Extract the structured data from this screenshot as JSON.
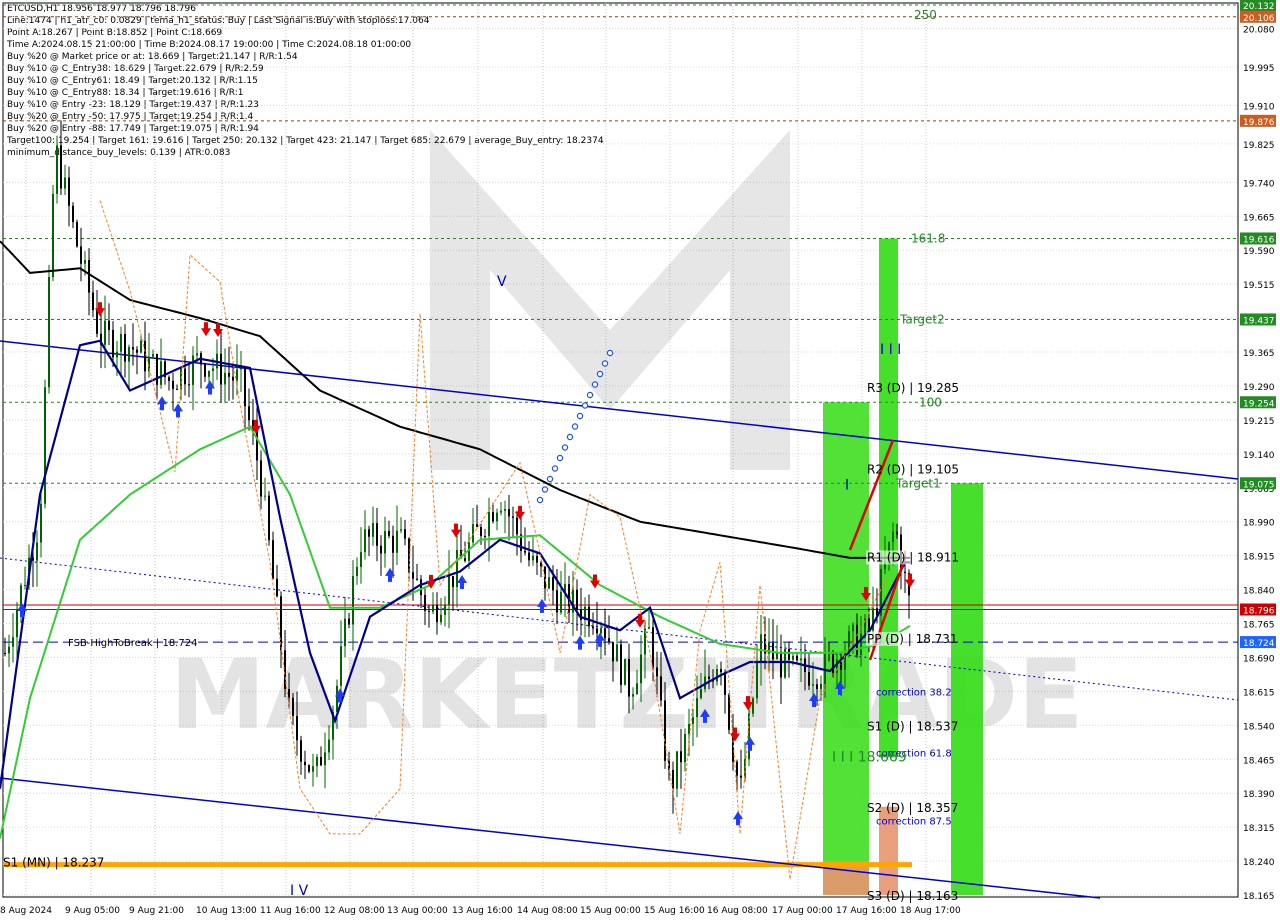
{
  "header_lines": [
    "ETCUSD,H1  18.956 18.977 18.796 18.796",
    "Line:1474  |  h1_atr_c0: 0.0829  |  tema_h1_status: Buy  |  Last Signal is:Buy with stoploss:17.064",
    "Point A:18.267  |  Point B:18.852  |  Point C:18.669",
    "Time A:2024.08.15 21:00:00  |  Time B:2024.08.17 19:00:00  |  Time C:2024.08.18 01:00:00",
    "Buy %20 @ Market price or at: 18.669  |  Target:21.147  |  R/R:1.54",
    "Buy %10 @ C_Entry38: 18.629  |  Target:22.679  |  R/R:2.59",
    "Buy %10 @ C_Entry61: 18.49  |  Target:20.132  |  R/R:1.15",
    "Buy %10 @ C_Entry88: 18.34  |  Target:19.616  |  R/R:1",
    "Buy %10 @ Entry -23: 18.129  |  Target:19.437  |  R/R:1.23",
    "Buy %20 @ Entry -50: 17.975  |  Target:19.254  |  R/R:1.4",
    "Buy %20 @ Entry -88: 17.749  |  Target:19.075  |  R/R:1.94",
    "Target100: 19.254  |  Target 161: 19.616  |  Target 250: 20.132  |  Target 423: 21.147  |  Target 685: 22.679  |  average_Buy_entry: 18.2374",
    "minimum_distance_buy_levels: 0.139  |  ATR:0.083"
  ],
  "watermark": "MARKETZITRADE",
  "colors": {
    "up_candle": "#006400",
    "down_candle": "#000000",
    "ema_black": "#000000",
    "ema_green": "#32cd32",
    "ema_navy": "#00008b",
    "channel_blue": "#0000cd",
    "level_green": "#228b22",
    "price_red": "#cc0000",
    "orange": "#ffa500",
    "green_zone": "#32dc14",
    "salmon_zone": "#e8956e"
  },
  "chart_data": {
    "type": "candlestick",
    "symbol": "ETCUSD,H1",
    "ohlc_header": {
      "open": 18.956,
      "high": 18.977,
      "low": 18.796,
      "close": 18.796
    },
    "ylim": [
      18.165,
      20.132
    ],
    "x_ticks": [
      "8 Aug 2024",
      "9 Aug 05:00",
      "9 Aug 21:00",
      "10 Aug 13:00",
      "11 Aug 16:00",
      "12 Aug 08:00",
      "13 Aug 00:00",
      "13 Aug 16:00",
      "14 Aug 08:00",
      "15 Aug 00:00",
      "15 Aug 16:00",
      "16 Aug 08:00",
      "17 Aug 00:00",
      "17 Aug 16:00",
      "18 Aug 17:00"
    ],
    "y_ticks": [
      "20.080",
      "19.995",
      "19.910",
      "19.825",
      "19.740",
      "19.665",
      "19.590",
      "19.515",
      "19.440",
      "19.365",
      "19.290",
      "19.215",
      "19.140",
      "19.065",
      "18.990",
      "18.915",
      "18.840",
      "18.765",
      "18.690",
      "18.615",
      "18.540",
      "18.465",
      "18.390",
      "18.315",
      "18.240",
      "18.165"
    ],
    "price_boxes": [
      {
        "label": "20.132",
        "value": 20.132,
        "color": "#228b22"
      },
      {
        "label": "20.106",
        "value": 20.106,
        "color": "#cd5c1e"
      },
      {
        "label": "19.876",
        "value": 19.876,
        "color": "#cd5c1e"
      },
      {
        "label": "19.616",
        "value": 19.616,
        "color": "#228b22"
      },
      {
        "label": "19.437",
        "value": 19.437,
        "color": "#228b22"
      },
      {
        "label": "19.254",
        "value": 19.254,
        "color": "#228b22"
      },
      {
        "label": "19.075",
        "value": 19.075,
        "color": "#228b22"
      },
      {
        "label": "18.796",
        "value": 18.796,
        "color": "#cc0000"
      },
      {
        "label": "18.724",
        "value": 18.724,
        "color": "#1e64ff"
      }
    ],
    "levels": [
      {
        "value": 20.132,
        "style": "dotted",
        "color": "#228b22"
      },
      {
        "value": 20.106,
        "style": "dotted",
        "color": "#8b4513"
      },
      {
        "value": 19.876,
        "style": "dotted",
        "color": "#8b4513"
      },
      {
        "value": 19.616,
        "style": "dotted",
        "color": "#228b22"
      },
      {
        "value": 19.437,
        "style": "dotted",
        "color": "#228b22"
      },
      {
        "value": 19.254,
        "style": "dotted",
        "color": "#228b22"
      },
      {
        "value": 19.075,
        "style": "dotted",
        "color": "#228b22"
      },
      {
        "value": 18.796,
        "style": "solid",
        "color": "#cc0000"
      },
      {
        "value": 18.724,
        "style": "dashed",
        "color": "#0000cd"
      }
    ],
    "annotations": [
      {
        "text": "250",
        "value": 20.132,
        "color": "#228b22"
      },
      {
        "text": "161.8",
        "value": 19.616,
        "color": "#228b22"
      },
      {
        "text": "Target2",
        "value": 19.437,
        "color": "#228b22"
      },
      {
        "text": "100",
        "value": 19.254,
        "color": "#228b22"
      },
      {
        "text": "Target1",
        "value": 19.075,
        "color": "#228b22"
      },
      {
        "text": "R3 (D) | 19.285",
        "value": 19.285,
        "color": "#000000"
      },
      {
        "text": "R2 (D) | 19.105",
        "value": 19.105,
        "color": "#000000"
      },
      {
        "text": "R1 (D) | 18.911",
        "value": 18.911,
        "color": "#000000"
      },
      {
        "text": "PP (D) | 18.731",
        "value": 18.731,
        "color": "#000000"
      },
      {
        "text": "S1 (D) | 18.537",
        "value": 18.537,
        "color": "#000000"
      },
      {
        "text": "S2 (D) | 18.357",
        "value": 18.357,
        "color": "#000000"
      },
      {
        "text": "S3 (D) | 18.163",
        "value": 18.163,
        "color": "#000000"
      },
      {
        "text": "correction 38.2",
        "value": 18.615,
        "color": "#0000cd"
      },
      {
        "text": "correction 61.8",
        "value": 18.48,
        "color": "#0000cd"
      },
      {
        "text": "correction 87.5",
        "value": 18.33,
        "color": "#0000cd"
      },
      {
        "text": "I I I 18.669",
        "value": 18.469,
        "color": "#228b22"
      },
      {
        "text": "S1 (MN) | 18.237",
        "value": 18.237,
        "color": "#000000"
      },
      {
        "text": "FSB-HighToBreak | 18.724",
        "value": 18.724,
        "color": "#000000"
      },
      {
        "text": "I I I",
        "value": 19.37,
        "color": "#0000cd"
      },
      {
        "text": "I V",
        "value": 18.165,
        "color": "#0000cd"
      },
      {
        "text": "V",
        "value": 19.52,
        "color": "#0000cd"
      },
      {
        "text": "I",
        "value": 19.07,
        "color": "#0000cd"
      }
    ],
    "last_price": 18.796
  }
}
